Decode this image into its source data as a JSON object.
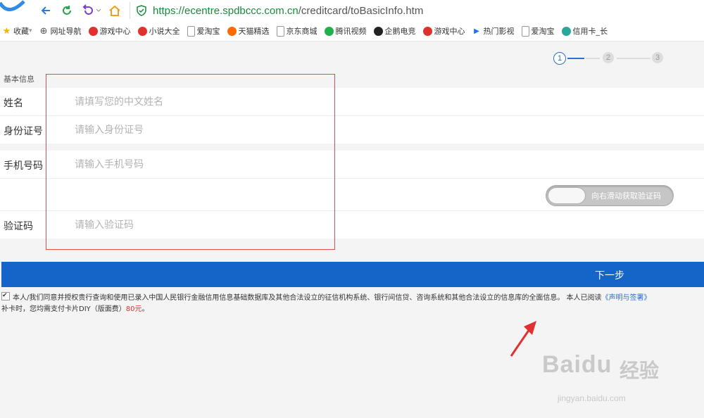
{
  "browser": {
    "url_host": "https://ecentre.spdbccc.com.cn",
    "url_path": "/creditcard/toBasicInfo.htm",
    "bookmarks": [
      {
        "label": "收藏",
        "icon": "star-icon",
        "color": "#f5b400"
      },
      {
        "label": "网址导航",
        "icon": "globe-icon",
        "color": "#555555"
      },
      {
        "label": "游戏中心",
        "icon": "game-icon",
        "color": "#e0312f"
      },
      {
        "label": "小说大全",
        "icon": "book-icon",
        "color": "#e0312f"
      },
      {
        "label": "爱淘宝",
        "icon": "page-icon",
        "color": "#999999"
      },
      {
        "label": "天猫精选",
        "icon": "tmall-icon",
        "color": "#ff6a00"
      },
      {
        "label": "京东商城",
        "icon": "page-icon",
        "color": "#999999"
      },
      {
        "label": "腾讯视频",
        "icon": "video-icon",
        "color": "#20b14b"
      },
      {
        "label": "企鹅电竞",
        "icon": "penguin-icon",
        "color": "#222222"
      },
      {
        "label": "游戏中心",
        "icon": "gamepad-icon",
        "color": "#e0312f"
      },
      {
        "label": "热门影视",
        "icon": "play-icon",
        "color": "#1a73e8"
      },
      {
        "label": "爱淘宝",
        "icon": "page-icon",
        "color": "#999999"
      },
      {
        "label": "信用卡_长",
        "icon": "crop-icon",
        "color": "#2aa69a"
      }
    ]
  },
  "steps": {
    "current": "1",
    "second": "2",
    "third": "3"
  },
  "form": {
    "section_title": "基本信息",
    "name_label": "姓名",
    "name_placeholder": "请填写您的中文姓名",
    "id_label": "身份证号",
    "id_placeholder": "请输入身份证号",
    "phone_label": "手机号码",
    "phone_placeholder": "请输入手机号码",
    "slider_text": "向右滑动获取验证码",
    "code_label": "验证码",
    "code_placeholder": "请输入验证码",
    "next_label": "下一步"
  },
  "agreement": {
    "text1": "本人/我们同意并授权贵行查询和使用已录入中国人民银行金融信用信息基础数据库及其他合法设立的征信机构系统、银行间信贷、咨询系统和其他合法设立的信息库的全面信息。 本人已阅读",
    "link": "《声明与签署》",
    "text2": "补卡时，您均需支付卡片DIY（版面费）",
    "fee": "80元",
    "text3": "。"
  },
  "watermark": {
    "brand": "Baidu",
    "brand_cn": "经验",
    "url": "jingyan.baidu.com"
  },
  "colors": {
    "primary": "#1565c8",
    "highlight": "#e64b4b",
    "url_green": "#1a8a3a"
  }
}
